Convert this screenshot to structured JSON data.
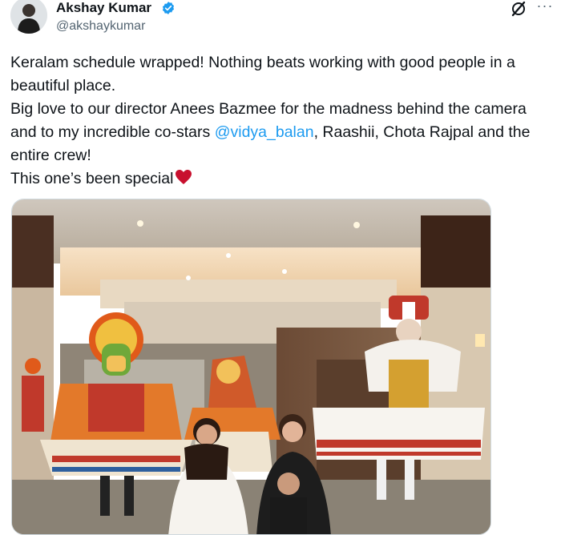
{
  "author": {
    "display_name": "Akshay Kumar",
    "handle": "@akshaykumar",
    "verified": true,
    "verified_color": "#1d9bf0"
  },
  "icons": {
    "grok": "grok-icon",
    "more": "more-icon",
    "heart": "red-heart-emoji",
    "verified": "verified-badge-icon"
  },
  "more_label": "···",
  "tweet": {
    "line1": "Keralam schedule wrapped! Nothing beats working with good people in a beautiful place.",
    "line2_pre": "Big love to our director Anees Bazmee for the madness behind the camera and to my incredible co-stars ",
    "mention": "@vidya_balan",
    "line2_post": ", Raashii, Chota Rajpal and the entire crew!",
    "line3": "This one’s been special",
    "mention_color": "#1d9bf0"
  },
  "media": {
    "type": "photo"
  }
}
